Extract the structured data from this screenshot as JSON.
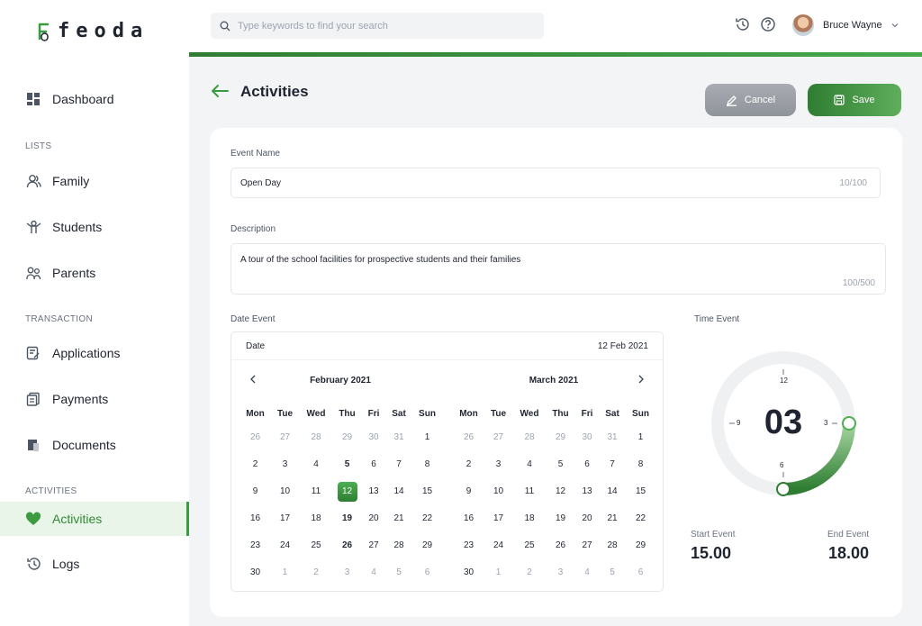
{
  "brand": {
    "name": "feoda",
    "color": "#3a9b40"
  },
  "sidebar": {
    "items": [
      {
        "label": "Dashboard",
        "icon": "dashboard-icon"
      },
      {
        "label": "Family",
        "icon": "family-icon"
      },
      {
        "label": "Students",
        "icon": "students-icon"
      },
      {
        "label": "Parents",
        "icon": "parents-icon"
      },
      {
        "label": "Applications",
        "icon": "applications-icon"
      },
      {
        "label": "Payments",
        "icon": "payments-icon"
      },
      {
        "label": "Documents",
        "icon": "documents-icon"
      },
      {
        "label": "Activities",
        "icon": "heart-icon",
        "active": true
      },
      {
        "label": "Logs",
        "icon": "logs-icon"
      }
    ],
    "sections": {
      "lists": "LISTS",
      "transaction": "TRANSACTION",
      "activities": "ACTIVITIES"
    }
  },
  "topbar": {
    "search_placeholder": "Type keywords to find your search",
    "user_name": "Bruce Wayne"
  },
  "page": {
    "title": "Activities",
    "cancel_label": "Cancel",
    "save_label": "Save"
  },
  "form": {
    "event_name": {
      "label": "Event Name",
      "value": "Open Day",
      "counter": "10/100"
    },
    "description": {
      "label": "Description",
      "value": "A tour of the school facilities for prospective students and their families",
      "counter": "100/500"
    },
    "date_event": {
      "label": "Date Event",
      "header_label": "Date",
      "value": "12 Feb 2021"
    },
    "time_event": {
      "label": "Time Event",
      "hour": "03",
      "start_label": "Start Event",
      "start_value": "15.00",
      "end_label": "End Event",
      "end_value": "18.00"
    }
  },
  "calendar": {
    "weekdays": [
      "Mon",
      "Tue",
      "Wed",
      "Thu",
      "Fri",
      "Sat",
      "Sun"
    ],
    "left": {
      "title": "February 2021",
      "days": [
        {
          "d": "26",
          "m": true
        },
        {
          "d": "27",
          "m": true
        },
        {
          "d": "28",
          "m": true
        },
        {
          "d": "29",
          "m": true
        },
        {
          "d": "30",
          "m": true
        },
        {
          "d": "31",
          "m": true
        },
        {
          "d": "1"
        },
        {
          "d": "2"
        },
        {
          "d": "3"
        },
        {
          "d": "4"
        },
        {
          "d": "5",
          "b": true
        },
        {
          "d": "6"
        },
        {
          "d": "7"
        },
        {
          "d": "8"
        },
        {
          "d": "9"
        },
        {
          "d": "10"
        },
        {
          "d": "11"
        },
        {
          "d": "12",
          "s": true
        },
        {
          "d": "13"
        },
        {
          "d": "14"
        },
        {
          "d": "15"
        },
        {
          "d": "16"
        },
        {
          "d": "17"
        },
        {
          "d": "18"
        },
        {
          "d": "19",
          "b": true
        },
        {
          "d": "20"
        },
        {
          "d": "21"
        },
        {
          "d": "22"
        },
        {
          "d": "23"
        },
        {
          "d": "24"
        },
        {
          "d": "25"
        },
        {
          "d": "26",
          "b": true
        },
        {
          "d": "27"
        },
        {
          "d": "28"
        },
        {
          "d": "29"
        },
        {
          "d": "30"
        },
        {
          "d": "1",
          "m": true
        },
        {
          "d": "2",
          "m": true
        },
        {
          "d": "3",
          "m": true
        },
        {
          "d": "4",
          "m": true
        },
        {
          "d": "5",
          "m": true
        },
        {
          "d": "6",
          "m": true
        }
      ]
    },
    "right": {
      "title": "March 2021",
      "days": [
        {
          "d": "26",
          "m": true
        },
        {
          "d": "27",
          "m": true
        },
        {
          "d": "28",
          "m": true
        },
        {
          "d": "29",
          "m": true
        },
        {
          "d": "30",
          "m": true
        },
        {
          "d": "31",
          "m": true
        },
        {
          "d": "1"
        },
        {
          "d": "2"
        },
        {
          "d": "3"
        },
        {
          "d": "4"
        },
        {
          "d": "5"
        },
        {
          "d": "6"
        },
        {
          "d": "7"
        },
        {
          "d": "8"
        },
        {
          "d": "9"
        },
        {
          "d": "10"
        },
        {
          "d": "11"
        },
        {
          "d": "12"
        },
        {
          "d": "13"
        },
        {
          "d": "14"
        },
        {
          "d": "15"
        },
        {
          "d": "16"
        },
        {
          "d": "17"
        },
        {
          "d": "18"
        },
        {
          "d": "19"
        },
        {
          "d": "20"
        },
        {
          "d": "21"
        },
        {
          "d": "22"
        },
        {
          "d": "23"
        },
        {
          "d": "24"
        },
        {
          "d": "25"
        },
        {
          "d": "26"
        },
        {
          "d": "27"
        },
        {
          "d": "28"
        },
        {
          "d": "29"
        },
        {
          "d": "30"
        },
        {
          "d": "1",
          "m": true
        },
        {
          "d": "2",
          "m": true
        },
        {
          "d": "3",
          "m": true
        },
        {
          "d": "4",
          "m": true
        },
        {
          "d": "5",
          "m": true
        },
        {
          "d": "6",
          "m": true
        }
      ]
    }
  },
  "clock": {
    "labels": [
      "12",
      "3",
      "6",
      "9"
    ],
    "arc_start_hour": 3,
    "arc_end_hour": 6
  }
}
